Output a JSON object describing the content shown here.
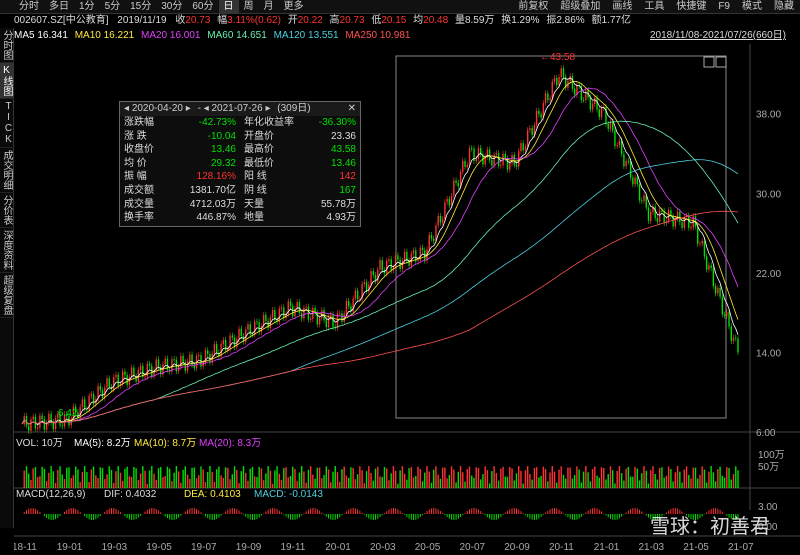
{
  "toolbar": {
    "tabs": [
      "分时",
      "多日",
      "1分",
      "5分",
      "15分",
      "30分",
      "60分",
      "日",
      "周",
      "月",
      "更多"
    ],
    "active": "日",
    "right": [
      "前复权",
      "超级叠加",
      "画线",
      "工具",
      "快捷键",
      "F9",
      "模式",
      "隐藏"
    ]
  },
  "info": {
    "code_name": "002607.SZ[中公教育]",
    "date": "2019/11/19",
    "close_label": "收",
    "close": "20.73",
    "change_label": "幅",
    "change": "3.11%(0.62)",
    "open_label": "开",
    "open": "20.22",
    "high_label": "高",
    "high": "20.73",
    "low_label": "低",
    "low": "20.15",
    "avg_label": "均",
    "avg": "20.48",
    "vol_label": "量",
    "vol": "8.59万",
    "turn_label": "换",
    "turn": "1.29%",
    "amp_label": "振",
    "amp": "2.86%",
    "amt_label": "额",
    "amt": "1.77亿"
  },
  "ma": {
    "ma5": "MA5 16.341",
    "ma10": "MA10 16.221",
    "ma20": "MA20 16.001",
    "ma60": "MA60 14.651",
    "ma120": "MA120 13.551",
    "ma250": "MA250 10.981",
    "range": "2018/11/08-2021/07/26(660日)"
  },
  "leftnav": [
    "分时图",
    "K线图",
    "TICK",
    "成交明细",
    "分价表",
    "深度资料",
    "超级复盘"
  ],
  "popup": {
    "start": "2020-04-20",
    "end": "2021-07-26",
    "days": "(309日)",
    "rows": [
      [
        [
          "涨跌幅",
          "-42.73%",
          "green"
        ],
        [
          "年化收益率",
          "-36.30%",
          "green"
        ]
      ],
      [
        [
          "涨 跌",
          "-10.04",
          "green"
        ],
        [
          "开盘价",
          "23.36",
          "white"
        ]
      ],
      [
        [
          "收盘价",
          "13.46",
          "green"
        ],
        [
          "最高价",
          "43.58",
          "green"
        ]
      ],
      [
        [
          "均 价",
          "29.32",
          "green"
        ],
        [
          "最低价",
          "13.46",
          "green"
        ]
      ],
      [
        [
          "振 幅",
          "128.16%",
          "red"
        ],
        [
          "阳 线",
          "142",
          "red"
        ]
      ],
      [
        [
          "成交额",
          "1381.70亿",
          "white"
        ],
        [
          "阴 线",
          "167",
          "green"
        ]
      ],
      [
        [
          "成交量",
          "4712.03万",
          "white"
        ],
        [
          "天量",
          "55.78万",
          "white"
        ]
      ],
      [
        [
          "换手率",
          "446.87%",
          "white"
        ],
        [
          "地量",
          "4.93万",
          "white"
        ]
      ]
    ]
  },
  "price_axis": [
    "38.00",
    "30.00",
    "22.00",
    "14.00",
    "6.00"
  ],
  "annotations": {
    "high": "43.58",
    "low": "6.42"
  },
  "volume": {
    "label": "VOL: 10万",
    "ma5": "MA(5): 8.2万",
    "ma10": "MA(10): 8.7万",
    "ma20": "MA(20): 8.3万",
    "axis": [
      "100万",
      "50万"
    ]
  },
  "macd": {
    "label": "MACD(12,26,9)",
    "dif": "DIF: 0.4032",
    "dea": "DEA: 0.4103",
    "macd": "MACD: -0.0143",
    "axis": [
      "3.00",
      "0.00"
    ]
  },
  "x_axis": [
    "18-11",
    "19-01",
    "19-03",
    "19-05",
    "19-07",
    "19-09",
    "19-11",
    "20-01",
    "20-03",
    "20-05",
    "20-07",
    "20-09",
    "20-11",
    "21-01",
    "21-03",
    "21-05",
    "21-07"
  ],
  "watermark": "雪球：初善君",
  "chart_data": {
    "type": "line",
    "x": [
      "18-11",
      "19-01",
      "19-03",
      "19-05",
      "19-07",
      "19-09",
      "19-11",
      "20-01",
      "20-03",
      "20-05",
      "20-07",
      "20-09",
      "20-11",
      "21-01",
      "21-03",
      "21-05",
      "21-07"
    ],
    "series": [
      {
        "name": "",
        "values": [
          6.8,
          7.2,
          11.0,
          12.5,
          13.2,
          16.0,
          18.5,
          17.0,
          22.5,
          24.0,
          34.0,
          33.0,
          42.0,
          38.0,
          28.0,
          27.0,
          14.0
        ]
      }
    ],
    "ylim": [
      6,
      44
    ]
  },
  "colors": {
    "up": "#ff3232",
    "down": "#00e000",
    "ma5": "#ffffff",
    "ma10": "#ffeb3b",
    "ma20": "#e040fb",
    "ma60": "#69f0ae",
    "ma120": "#4dd0e1",
    "ma250": "#ff5252"
  }
}
